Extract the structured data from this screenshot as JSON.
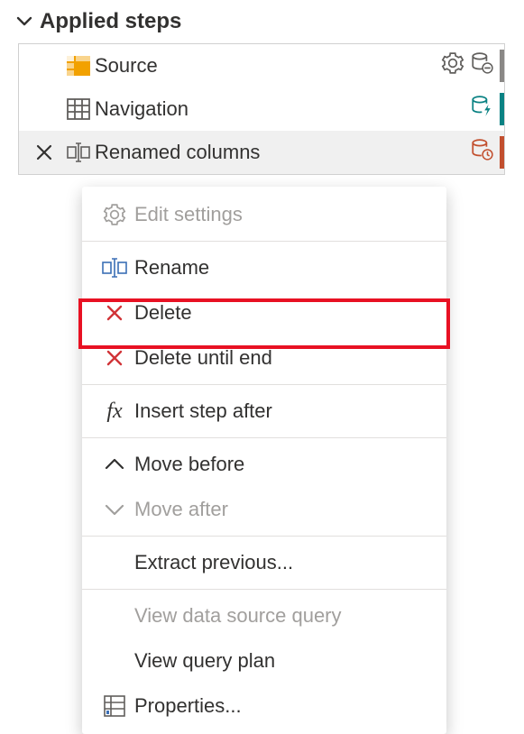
{
  "header": {
    "title": "Applied steps"
  },
  "steps": [
    {
      "label": "Source",
      "accent": "#8a8886"
    },
    {
      "label": "Navigation",
      "accent": "#0a8283"
    },
    {
      "label": "Renamed columns",
      "accent": "#c24f2e"
    }
  ],
  "context_menu": {
    "edit_settings": "Edit settings",
    "rename": "Rename",
    "delete": "Delete",
    "delete_until_end": "Delete until end",
    "insert_step_after": "Insert step after",
    "move_before": "Move before",
    "move_after": "Move after",
    "extract_previous": "Extract previous...",
    "view_data_source_query": "View data source query",
    "view_query_plan": "View query plan",
    "properties": "Properties..."
  }
}
